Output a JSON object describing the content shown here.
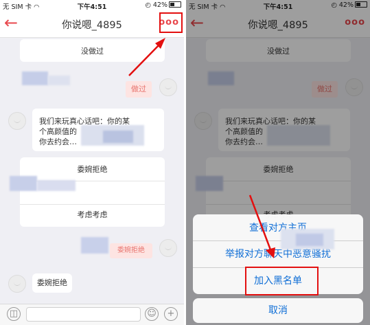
{
  "colors": {
    "accent": "#e8474c",
    "ios_blue": "#0f6ed6",
    "highlight": "#e30f0f"
  },
  "status_bar": {
    "carrier": "无 SIM 卡",
    "wifi_icon": "wifi-icon",
    "time": "下午4:51",
    "battery": "42%"
  },
  "nav": {
    "back_icon": "arrow-left-icon",
    "title": "你说嗯_4895",
    "more_label": "ooo"
  },
  "chat": {
    "card_top": "没做过",
    "pink_reply": "做过",
    "message_lines": [
      "我们来玩真心话吧：你的某",
      "个高颜值的",
      "你去约会…"
    ],
    "card_options": [
      "委婉拒绝",
      "考虑考虑"
    ],
    "pink_reply_2": "委婉拒绝",
    "bottom_bubble": "委婉拒绝"
  },
  "action_sheet": {
    "items": [
      "查看对方主页",
      "举报对方聊天中恶意骚扰",
      "加入黑名单"
    ],
    "cancel": "取消"
  },
  "input_bar": {
    "voice_icon": "voice-icon",
    "emoji_icon": "emoji-icon",
    "plus_icon": "plus-icon"
  }
}
